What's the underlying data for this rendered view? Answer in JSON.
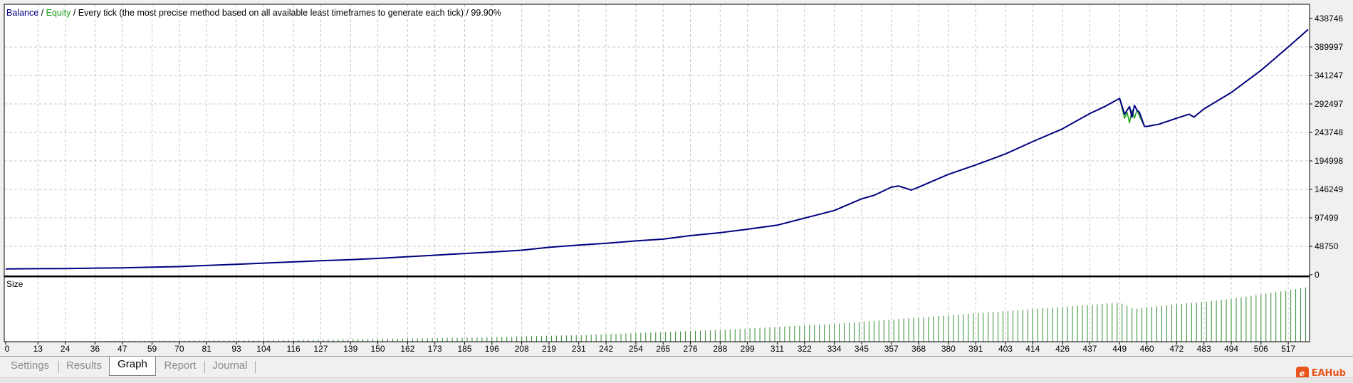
{
  "header": {
    "balance_label": "Balance",
    "sep1": " / ",
    "equity_label": "Equity",
    "description": " / Every tick (the most precise method based on all available least timeframes to generate each tick) / 99.90%"
  },
  "lower_panel": {
    "title": "Size"
  },
  "tabs": [
    {
      "label": "Settings",
      "active": false
    },
    {
      "label": "Results",
      "active": false
    },
    {
      "label": "Graph",
      "active": true
    },
    {
      "label": "Report",
      "active": false
    },
    {
      "label": "Journal",
      "active": false
    }
  ],
  "brand": {
    "icon_glyph": "ℯ",
    "text": "EAHub"
  },
  "colors": {
    "balance": "#000080",
    "equity": "#1b9e1b",
    "volume": "#2e8b2e",
    "grid": "#c8c8c8",
    "background": "#ffffff"
  },
  "chart_data": {
    "type": "line",
    "series": [
      {
        "name": "Balance",
        "x": [
          0,
          13,
          24,
          36,
          47,
          59,
          70,
          81,
          93,
          104,
          116,
          127,
          139,
          150,
          162,
          173,
          185,
          196,
          208,
          219,
          231,
          242,
          254,
          265,
          276,
          288,
          299,
          311,
          322,
          334,
          345,
          350,
          353,
          357,
          360,
          365,
          368,
          380,
          391,
          403,
          414,
          426,
          437,
          443,
          449,
          451,
          453,
          454,
          455,
          456,
          457,
          459,
          460,
          465,
          472,
          477,
          479,
          483,
          494,
          506,
          517,
          525
        ],
        "values": [
          10000,
          10500,
          10600,
          11500,
          12000,
          13000,
          14000,
          16000,
          18000,
          20000,
          22000,
          24000,
          26000,
          28000,
          31000,
          33500,
          36500,
          39000,
          42000,
          47000,
          51000,
          54000,
          58000,
          61000,
          67000,
          72000,
          78000,
          85000,
          97000,
          110000,
          130000,
          136000,
          142000,
          150000,
          152000,
          145000,
          150000,
          172000,
          188000,
          207000,
          228000,
          250000,
          276000,
          288000,
          302000,
          275000,
          288000,
          270000,
          290000,
          282000,
          278000,
          254000,
          254000,
          258000,
          268000,
          275000,
          270000,
          284000,
          312000,
          350000,
          390000,
          420000
        ]
      },
      {
        "name": "Equity",
        "x": [
          449,
          451,
          452,
          453,
          454,
          455,
          456,
          457,
          459
        ],
        "values": [
          302000,
          268000,
          278000,
          260000,
          282000,
          268000,
          282000,
          272000,
          254000
        ]
      }
    ],
    "y_ticks": [
      "438746",
      "389997",
      "341247",
      "292497",
      "243748",
      "194998",
      "146249",
      "97499",
      "48750",
      "0"
    ],
    "ylim": [
      0,
      438746
    ],
    "x_ticks": [
      "0",
      "13",
      "24",
      "36",
      "47",
      "59",
      "70",
      "81",
      "93",
      "104",
      "116",
      "127",
      "139",
      "150",
      "162",
      "173",
      "185",
      "196",
      "208",
      "219",
      "231",
      "242",
      "254",
      "265",
      "276",
      "288",
      "299",
      "311",
      "322",
      "334",
      "345",
      "357",
      "368",
      "380",
      "391",
      "403",
      "414",
      "426",
      "437",
      "449",
      "460",
      "472",
      "483",
      "494",
      "506",
      "517"
    ],
    "xlim": [
      0,
      525
    ],
    "volume": {
      "name": "Size",
      "x": [
        0,
        59,
        116,
        173,
        231,
        288,
        334,
        391,
        437,
        449,
        455,
        460,
        494,
        525
      ],
      "values": [
        0.2,
        0.8,
        1.5,
        3.0,
        5.5,
        10.0,
        15.0,
        24.0,
        31.0,
        33.0,
        27.5,
        29.0,
        36.0,
        46.0
      ],
      "max": 48
    },
    "grid": true
  }
}
